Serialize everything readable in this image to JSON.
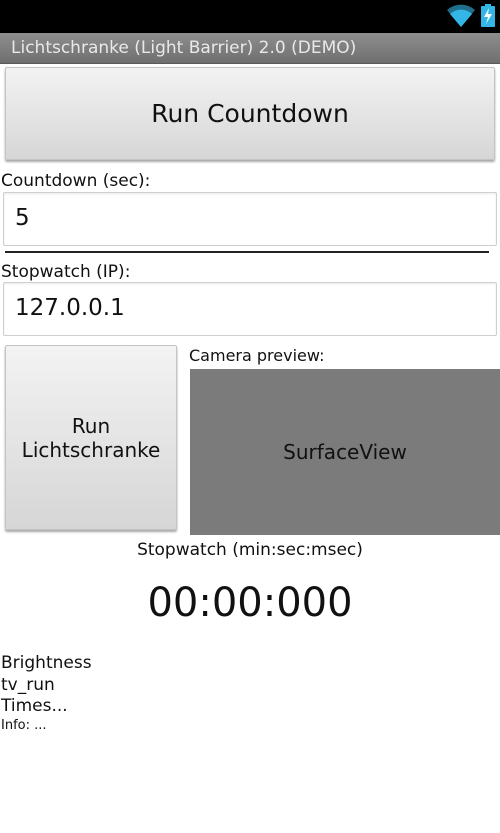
{
  "status_bar": {
    "icons": [
      "wifi-icon",
      "battery-charging-icon"
    ],
    "accent": "#33b5e5"
  },
  "app": {
    "title": "Lichtschranke (Light Barrier) 2.0 (DEMO)"
  },
  "countdown": {
    "button_label": "Run Countdown",
    "label": "Countdown (sec):",
    "value": "5"
  },
  "stopwatch": {
    "label": "Stopwatch (IP):",
    "value": "127.0.0.1"
  },
  "lichtschranke": {
    "button_label": "Run\nLichtschranke"
  },
  "camera": {
    "label": "Camera preview:",
    "surface_label": "SurfaceView"
  },
  "timer": {
    "caption": "Stopwatch (min:sec:msec)",
    "display": "00:00:000"
  },
  "info": {
    "brightness": "Brightness",
    "run": "tv_run",
    "times": "Times...",
    "info": "Info: ..."
  }
}
